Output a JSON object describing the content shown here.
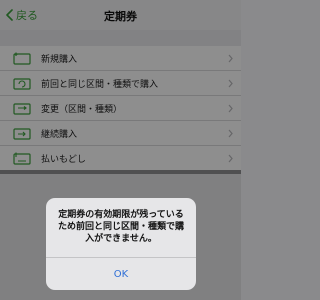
{
  "nav": {
    "back_label": "戻る",
    "title": "定期券"
  },
  "menu": {
    "items": [
      {
        "label": "新規購入",
        "icon": "ticket-new-icon"
      },
      {
        "label": "前回と同じ区間・種類で購入",
        "icon": "ticket-repeat-icon"
      },
      {
        "label": "変更（区間・種類）",
        "icon": "ticket-change-icon"
      },
      {
        "label": "継続購入",
        "icon": "ticket-renew-icon"
      },
      {
        "label": "払いもどし",
        "icon": "ticket-refund-icon"
      }
    ]
  },
  "alert": {
    "message": "定期券の有効期限が残っているため前回と同じ区間・種類で購入ができません。",
    "ok_label": "OK"
  },
  "colors": {
    "accent_green": "#3a9a3a",
    "link_blue": "#2f6fd6"
  }
}
